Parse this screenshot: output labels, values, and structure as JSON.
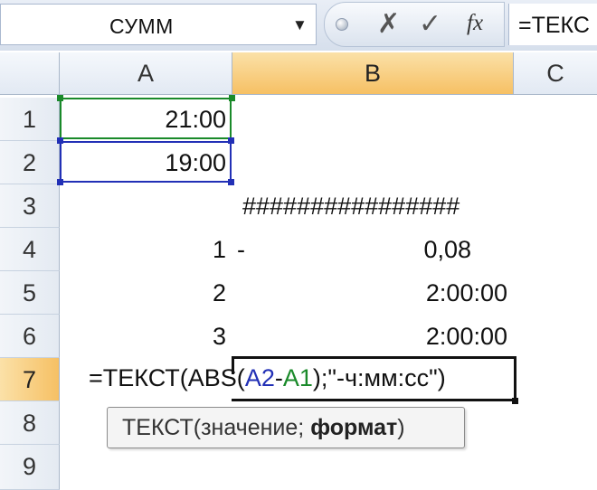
{
  "formula_bar": {
    "name_box": "СУММ",
    "cancel_icon": "✗",
    "enter_icon": "✓",
    "fx_label": "fx",
    "content": "=ТЕКС"
  },
  "columns": [
    {
      "label": "A",
      "active": false
    },
    {
      "label": "B",
      "active": true
    },
    {
      "label": "C",
      "active": false
    }
  ],
  "rows": [
    "1",
    "2",
    "3",
    "4",
    "5",
    "6",
    "7",
    "8",
    "9"
  ],
  "active_row": "7",
  "cells": {
    "A1": "21:00",
    "A2": "19:00",
    "B3": "################",
    "A4": "1",
    "A4_dash": "-",
    "B4": "0,08",
    "A5": "2",
    "B5": "2:00:00",
    "A6": "3",
    "B6": "2:00:00"
  },
  "formula_edit": {
    "part1": "=ТЕКСТ(ABS(",
    "ref1": "A2",
    "minus": "-",
    "ref2": "A1",
    "part2": ");\"-ч:мм:сс\")"
  },
  "tooltip": {
    "func": "ТЕКСТ(",
    "arg1": "значение; ",
    "arg2": "формат",
    "close": ")"
  },
  "colors": {
    "ref1": "#2230b6",
    "ref2": "#1a8a2a",
    "active_header": "#f6c064"
  }
}
